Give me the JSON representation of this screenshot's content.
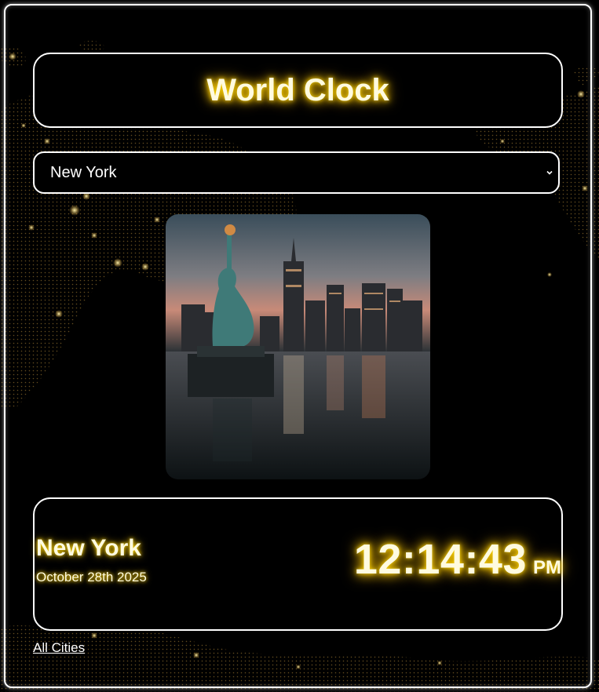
{
  "app": {
    "title": "World Clock"
  },
  "city_select": {
    "selected": "New York",
    "icon": "chevron-down-icon"
  },
  "city_image": {
    "subject": "Statue of Liberty and Manhattan skyline at dusk"
  },
  "clock": {
    "city": "New York",
    "date": "October 28th 2025",
    "time": "12:14:43",
    "ampm": "PM"
  },
  "footer": {
    "all_cities_label": "All Cities"
  },
  "colors": {
    "glow": "#ffd700",
    "text": "#fffbe0",
    "border": "#ffffff",
    "background": "#000000"
  }
}
